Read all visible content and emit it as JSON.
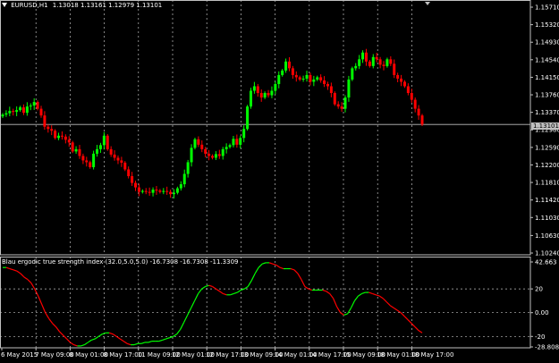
{
  "main_chart": {
    "symbol_label": "EURUSD,H1",
    "ohlc_label": "1.13018 1.13161 1.12979 1.13101",
    "current_price": "1.13101",
    "y_ticks": [
      "1.15710",
      "1.15320",
      "1.14930",
      "1.14540",
      "1.14150",
      "1.13760",
      "1.13370",
      "1.12980",
      "1.12590",
      "1.12200",
      "1.11810",
      "1.11420",
      "1.11030",
      "1.10630",
      "1.10240"
    ],
    "up_color": "#00ff00",
    "down_color": "#ff0000",
    "grid_color": "#c0c0c0"
  },
  "indicator": {
    "label": "Blau ergodic true strength index (32.0,5.0,5.0) -16.7308 -16.7308 -11.3309",
    "y_ticks": [
      "42.663",
      "20",
      "0.00",
      "-20",
      "-28.8089"
    ]
  },
  "x_axis": {
    "labels": [
      "6 May 2015",
      "7 May 09:00",
      "8 May 01:00",
      "8 May 17:00",
      "11 May 09:00",
      "12 May 01:00",
      "12 May 17:00",
      "13 May 09:00",
      "14 May 01:00",
      "14 May 17:00",
      "15 May 09:00",
      "18 May 01:00",
      "18 May 17:00"
    ]
  },
  "chart_data": [
    {
      "type": "candlestick",
      "title": "EURUSD,H1",
      "x_start": "6 May 2015",
      "ylim": [
        1.1024,
        1.1571
      ],
      "close_series": [
        1.1332,
        1.1335,
        1.134,
        1.1338,
        1.1342,
        1.1348,
        1.1336,
        1.135,
        1.1352,
        1.136,
        1.1345,
        1.133,
        1.1305,
        1.13,
        1.1296,
        1.128,
        1.1285,
        1.1283,
        1.1276,
        1.127,
        1.125,
        1.1255,
        1.124,
        1.123,
        1.1226,
        1.1215,
        1.1245,
        1.1255,
        1.1264,
        1.1285,
        1.1255,
        1.1243,
        1.1236,
        1.123,
        1.1225,
        1.121,
        1.1195,
        1.118,
        1.117,
        1.116,
        1.1162,
        1.116,
        1.1158,
        1.1165,
        1.1163,
        1.116,
        1.1162,
        1.116,
        1.1155,
        1.1158,
        1.1168,
        1.1177,
        1.12,
        1.1226,
        1.1258,
        1.1277,
        1.1265,
        1.1255,
        1.1245,
        1.124,
        1.1236,
        1.1244,
        1.124,
        1.1255,
        1.126,
        1.1264,
        1.1278,
        1.1265,
        1.128,
        1.13,
        1.135,
        1.1385,
        1.1395,
        1.138,
        1.137,
        1.138,
        1.1375,
        1.1385,
        1.14,
        1.142,
        1.143,
        1.145,
        1.1435,
        1.142,
        1.1415,
        1.141,
        1.1412,
        1.142,
        1.1405,
        1.141,
        1.1415,
        1.1408,
        1.14,
        1.1395,
        1.138,
        1.1355,
        1.135,
        1.1345,
        1.137,
        1.141,
        1.1435,
        1.144,
        1.1455,
        1.147,
        1.145,
        1.144,
        1.146,
        1.1455,
        1.1443,
        1.144,
        1.1455,
        1.1445,
        1.142,
        1.1412,
        1.1405,
        1.1395,
        1.138,
        1.1365,
        1.1345,
        1.133,
        1.131
      ]
    },
    {
      "type": "line",
      "title": "Blau ergodic true strength index (32.0,5.0,5.0) -16.7308 -16.7308 -11.3309",
      "ylim": [
        -28.8089,
        42.663
      ],
      "values": [
        38,
        38,
        37,
        36,
        35,
        33,
        30,
        28,
        25,
        20,
        14,
        7,
        0,
        -5,
        -9,
        -12,
        -16,
        -19,
        -22,
        -25,
        -27,
        -28,
        -28,
        -27,
        -25,
        -23,
        -22,
        -20,
        -18,
        -17,
        -17,
        -18,
        -20,
        -22,
        -24,
        -26,
        -27,
        -27,
        -26,
        -26,
        -25,
        -25,
        -24,
        -24,
        -24,
        -23,
        -22,
        -21,
        -20,
        -18,
        -14,
        -8,
        -2,
        4,
        10,
        16,
        20,
        22,
        23,
        22,
        20,
        18,
        16,
        15,
        15,
        16,
        17,
        19,
        20,
        22,
        27,
        33,
        38,
        41,
        42,
        42,
        41,
        40,
        38,
        37,
        37,
        37,
        36,
        33,
        28,
        22,
        20,
        19,
        19,
        19,
        19,
        18,
        16,
        12,
        5,
        0,
        -2,
        -1,
        4,
        10,
        14,
        16,
        17,
        17,
        16,
        15,
        14,
        12,
        9,
        6,
        4,
        2,
        0,
        -3,
        -6,
        -9,
        -12,
        -15,
        -17
      ]
    }
  ]
}
